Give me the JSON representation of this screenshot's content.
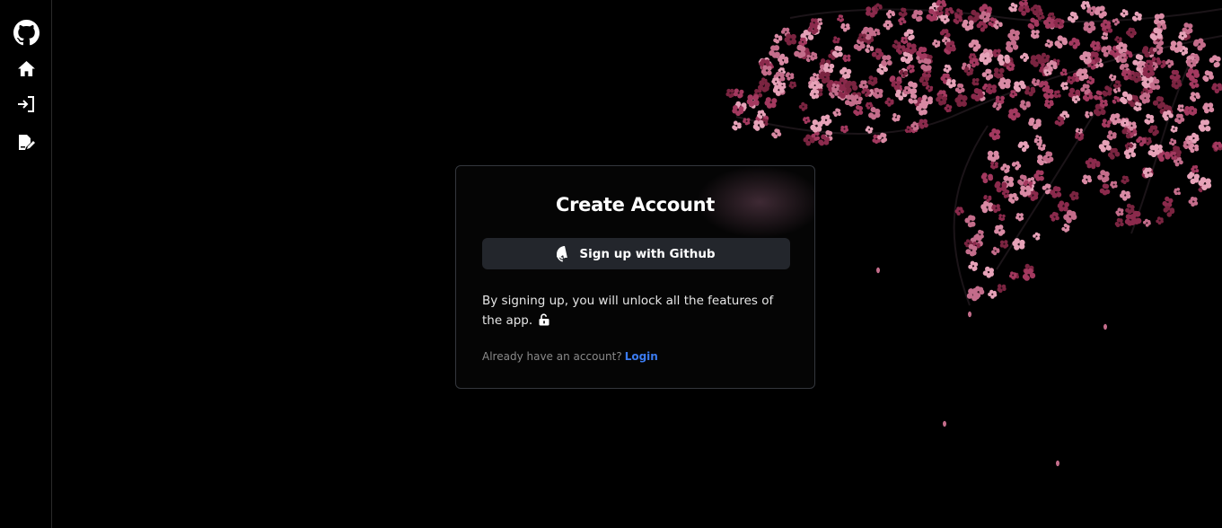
{
  "sidebar": {
    "icons": [
      "github-icon",
      "home-icon",
      "sign-in-icon",
      "file-signature-icon"
    ]
  },
  "card": {
    "title": "Create Account",
    "github_button_label": "Sign up with Github",
    "info_text": "By signing up, you will unlock all the features of the app.",
    "login_prompt": "Already have an account?",
    "login_link": "Login"
  },
  "colors": {
    "background": "#000000",
    "button": "#23262c",
    "link": "#3b7bf0",
    "card_border": "#34373d"
  }
}
